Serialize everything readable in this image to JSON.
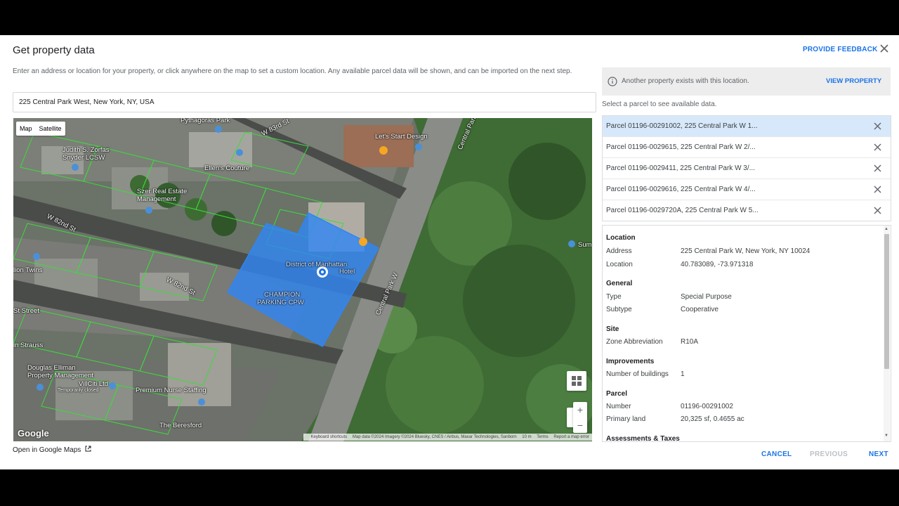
{
  "dialog": {
    "title": "Get property data",
    "feedback_label": "PROVIDE FEEDBACK",
    "intro": "Enter an address or location for your property, or click anywhere on the map to set a custom location. Any available parcel data will be shown, and can be imported on the next step."
  },
  "search": {
    "value": "225 Central Park West, New York, NY, USA"
  },
  "map": {
    "toggle": [
      "Map",
      "Satellite"
    ],
    "labels": [
      "Pythagoras Park",
      "W 83rd St",
      "Let's Start Design",
      "Central Park",
      "Judith S. Zorfas",
      "Snyder LCSW",
      "Ellen's Couture",
      "Szer Real Estate",
      "Management",
      "W 82nd St",
      "W 82nd St",
      "lion Twins",
      "District of Manhattan",
      "Hotel",
      "CHAMPION",
      "PARKING CPW",
      "Central Park W",
      "Sum",
      "St Street",
      "in Strauss",
      "Douglas Elliman",
      "Property Management",
      "VillCiti Ltd",
      "Temporarily closed",
      "Premium Nurse Staffing",
      "The Beresford"
    ],
    "google_logo": "Google",
    "attribution": [
      "Keyboard shortcuts",
      "Map data ©2024 Imagery ©2024 Bluesky, CNES / Airbus, Maxar Technologies, Sanborn",
      "10 m",
      "Terms",
      "Report a map error"
    ],
    "open_maps_label": "Open in Google Maps"
  },
  "notice": {
    "message": "Another property exists with this location.",
    "action": "VIEW PROPERTY"
  },
  "parcels": {
    "hint": "Select a parcel to see available data.",
    "items": [
      "Parcel 01196-00291002, 225 Central Park W 1...",
      "Parcel 01196-0029615, 225 Central Park W 2/...",
      "Parcel 01196-0029411, 225 Central Park W 3/...",
      "Parcel 01196-0029616, 225 Central Park W 4/...",
      "Parcel 01196-0029720A, 225 Central Park W 5..."
    ]
  },
  "details": {
    "location_title": "Location",
    "address_key": "Address",
    "address_val": "225 Central Park W, New York, NY 10024",
    "location_key": "Location",
    "location_val": "40.783089, -73.971318",
    "general_title": "General",
    "type_key": "Type",
    "type_val": "Special Purpose",
    "subtype_key": "Subtype",
    "subtype_val": "Cooperative",
    "site_title": "Site",
    "zone_key": "Zone Abbreviation",
    "zone_val": "R10A",
    "improvements_title": "Improvements",
    "buildings_key": "Number of buildings",
    "buildings_val": "1",
    "parcel_title": "Parcel",
    "number_key": "Number",
    "number_val": "01196-00291002",
    "land_key": "Primary land",
    "land_val": "20,325 sf, 0.4655 ac",
    "assess_title": "Assessments & Taxes"
  },
  "footer": {
    "cancel": "CANCEL",
    "previous": "PREVIOUS",
    "next": "NEXT"
  },
  "colors": {
    "accent": "#1a73e8",
    "parcel_highlight": "#2f86f5",
    "parcel_outline": "#3bdc3b",
    "selected_row": "#d7e8fb",
    "disabled": "#bdc1c6"
  }
}
